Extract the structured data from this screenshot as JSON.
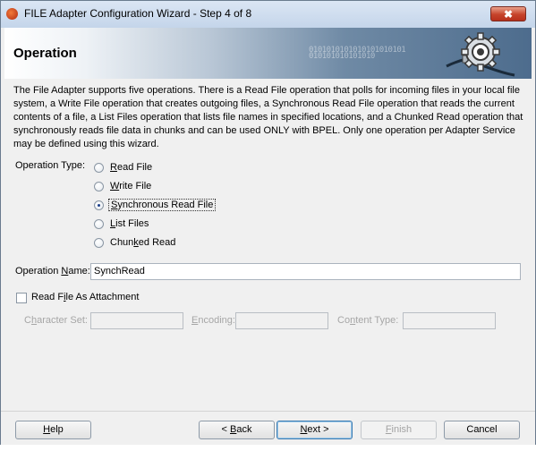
{
  "window": {
    "title": "FILE Adapter Configuration Wizard - Step 4 of 8",
    "close_symbol": "✖"
  },
  "banner": {
    "title": "Operation",
    "bits": "0101010101010101010101\n010101010101010"
  },
  "description": "The File Adapter supports five operations.  There is a Read File operation that polls for incoming files in your local file system, a Write File operation that creates outgoing files, a Synchronous Read File operation that reads the current contents of a file, a List Files operation that lists file names in specified locations, and a Chunked Read operation that synchronously reads file data in chunks and can be used ONLY with BPEL. Only one operation per Adapter Service may be defined using this wizard.",
  "operation_type": {
    "label": "Operation Type:",
    "options": [
      {
        "pre": "",
        "mn": "R",
        "post": "ead File",
        "checked": false
      },
      {
        "pre": "",
        "mn": "W",
        "post": "rite File",
        "checked": false
      },
      {
        "pre": "",
        "mn": "S",
        "post": "ynchronous Read File",
        "checked": true
      },
      {
        "pre": "",
        "mn": "L",
        "post": "ist Files",
        "checked": false
      },
      {
        "pre": "Chun",
        "mn": "k",
        "post": "ed Read",
        "checked": false
      }
    ]
  },
  "operation_name": {
    "label_pre": "Operation ",
    "label_mn": "N",
    "label_post": "ame:",
    "value": "SynchRead"
  },
  "attachment": {
    "pre": "Read F",
    "mn": "i",
    "post": "le As Attachment",
    "checked": false
  },
  "character_set": {
    "pre": "C",
    "mn": "h",
    "post": "aracter Set:",
    "value": ""
  },
  "encoding": {
    "pre": "",
    "mn": "E",
    "post": "ncoding:",
    "value": ""
  },
  "content_type": {
    "pre": "Co",
    "mn": "n",
    "post": "tent Type:",
    "value": ""
  },
  "buttons": {
    "help": {
      "pre": "",
      "mn": "H",
      "post": "elp"
    },
    "back": {
      "pre": "< ",
      "mn": "B",
      "post": "ack"
    },
    "next": {
      "pre": "",
      "mn": "N",
      "post": "ext >"
    },
    "finish": {
      "pre": "",
      "mn": "F",
      "post": "inish"
    },
    "cancel": {
      "pre": "",
      "mn": "",
      "post": "Cancel"
    }
  },
  "colors": {
    "title_bar": "#c4d5ea",
    "close_red": "#c6432a",
    "banner_dark": "#4d6c8d",
    "radio_dot": "#1c3f8a"
  }
}
